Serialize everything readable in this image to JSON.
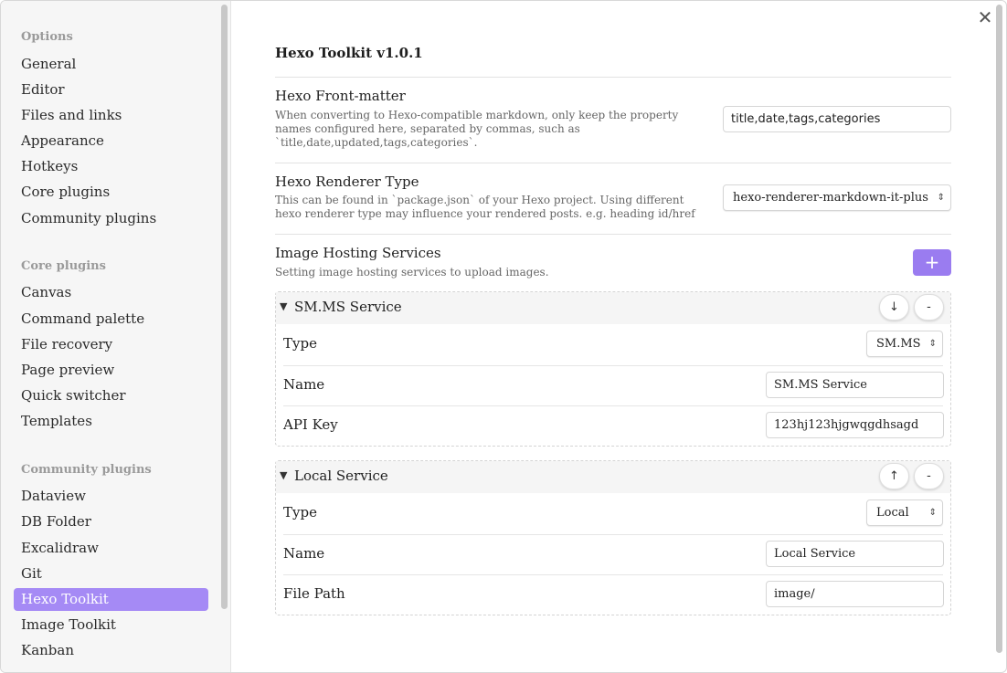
{
  "sidebar": {
    "groups": [
      {
        "title": "Options",
        "items": [
          "General",
          "Editor",
          "Files and links",
          "Appearance",
          "Hotkeys",
          "Core plugins",
          "Community plugins"
        ]
      },
      {
        "title": "Core plugins",
        "items": [
          "Canvas",
          "Command palette",
          "File recovery",
          "Page preview",
          "Quick switcher",
          "Templates"
        ]
      },
      {
        "title": "Community plugins",
        "items": [
          "Dataview",
          "DB Folder",
          "Excalidraw",
          "Git",
          "Hexo Toolkit",
          "Image Toolkit",
          "Kanban"
        ]
      }
    ],
    "active_item": "Hexo Toolkit"
  },
  "main": {
    "close_icon": "✕",
    "plugin_title": "Hexo Toolkit v1.0.1",
    "front_matter": {
      "name": "Hexo Front-matter",
      "desc": "When converting to Hexo-compatible markdown, only keep the property names configured here, separated by commas, such as `title,date,updated,tags,categories`.",
      "value": "title,date,tags,categories"
    },
    "renderer": {
      "name": "Hexo Renderer Type",
      "desc": "This can be found in `package.json` of your Hexo project. Using different hexo renderer type may influence your rendered posts. e.g. heading id/href",
      "value": "hexo-renderer-markdown-it-plus"
    },
    "image_hosting": {
      "name": "Image Hosting Services",
      "desc": "Setting image hosting services to upload images.",
      "add_label": "+"
    },
    "services": [
      {
        "title": "SM.MS Service",
        "move_label": "↓",
        "remove_label": "-",
        "rows": [
          {
            "label": "Type",
            "value": "SM.MS"
          },
          {
            "label": "Name",
            "value": "SM.MS Service"
          },
          {
            "label": "API Key",
            "value": "123hj123hjgwqgdhsagd"
          }
        ]
      },
      {
        "title": "Local Service",
        "move_label": "↑",
        "remove_label": "-",
        "rows": [
          {
            "label": "Type",
            "value": "Local"
          },
          {
            "label": "Name",
            "value": "Local Service"
          },
          {
            "label": "File Path",
            "value": "image/"
          }
        ]
      }
    ]
  },
  "colors": {
    "accent": "#a58af5",
    "button_accent": "#9a7cf0",
    "sidebar_bg": "#f6f6f6"
  }
}
